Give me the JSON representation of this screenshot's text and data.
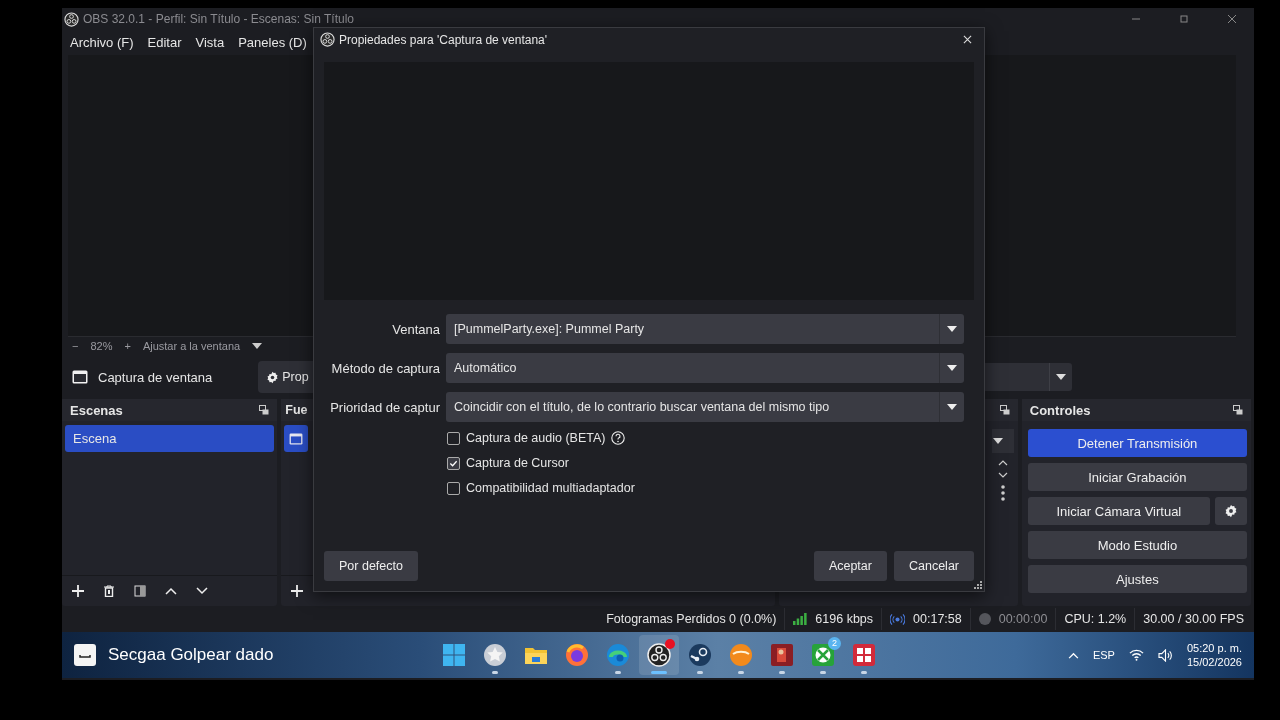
{
  "window": {
    "title": "OBS 32.0.1 - Perfil: Sin Título - Escenas: Sin Título"
  },
  "menu": [
    {
      "label": "Archivo (F)"
    },
    {
      "label": "Editar"
    },
    {
      "label": "Vista"
    },
    {
      "label": "Paneles (D)"
    }
  ],
  "zoom_bar": {
    "minus": "−",
    "zoom": "82%",
    "plus": "+",
    "fit": "Ajustar a la ventana"
  },
  "source_toolbar": {
    "source": "Captura de ventana",
    "properties_button": "Prop"
  },
  "scenes": {
    "title": "Escenas",
    "items": [
      {
        "label": "Escena",
        "selected": true
      }
    ]
  },
  "sources": {
    "title": "Fue",
    "items": [
      {
        "selected": true
      }
    ]
  },
  "controls": {
    "title": "Controles",
    "buttons": [
      {
        "label": "Detener Transmisión",
        "on": true,
        "gear": false
      },
      {
        "label": "Iniciar Grabación",
        "on": false,
        "gear": false
      },
      {
        "label": "Iniciar Cámara Virtual",
        "on": false,
        "gear": true
      },
      {
        "label": "Modo Estudio",
        "on": false,
        "gear": false
      },
      {
        "label": "Ajustes",
        "on": false,
        "gear": false
      }
    ]
  },
  "status_bar": {
    "dropped": "Fotogramas Perdidos 0 (0.0%)",
    "bitrate": "6196 kbps",
    "stream_time": "00:17:58",
    "record_time": "00:00:00",
    "cpu": "CPU: 1.2%",
    "fps": "30.00 / 30.00 FPS"
  },
  "dialog": {
    "title": "Propiedades para 'Captura de ventana'",
    "fields": [
      {
        "label": "Ventana",
        "value": "[PummelParty.exe]: Pummel Party"
      },
      {
        "label": "Método de captura",
        "value": "Automático"
      },
      {
        "label": "Prioridad de captur",
        "value": "Coincidir con el título, de lo contrario buscar ventana del mismo tipo"
      }
    ],
    "checkboxes": [
      {
        "label": "Captura de audio (BETA)",
        "checked": false,
        "help": true
      },
      {
        "label": "Captura de Cursor",
        "checked": true,
        "help": false
      },
      {
        "label": "Compatibilidad multiadaptador",
        "checked": false,
        "help": false
      }
    ],
    "defaults_button": "Por defecto",
    "ok_button": "Aceptar",
    "cancel_button": "Cancelar"
  },
  "taskbar": {
    "widget": "Secgaa Golpear dado",
    "apps": [
      {
        "kind": "start",
        "running": false,
        "active": false,
        "notification": false
      },
      {
        "kind": "star",
        "running": true,
        "active": false,
        "notification": false
      },
      {
        "kind": "folder",
        "running": false,
        "active": false,
        "notification": false
      },
      {
        "kind": "firefox",
        "running": false,
        "active": false,
        "notification": false
      },
      {
        "kind": "edge",
        "running": true,
        "active": false,
        "notification": false
      },
      {
        "kind": "obs",
        "running": true,
        "active": true,
        "notification": true
      },
      {
        "kind": "steam",
        "running": true,
        "active": false,
        "notification": false
      },
      {
        "kind": "orange",
        "running": true,
        "active": false,
        "notification": false
      },
      {
        "kind": "game",
        "running": true,
        "active": false,
        "notification": false
      },
      {
        "kind": "xbox",
        "running": true,
        "active": false,
        "notification": false,
        "badge": "2"
      },
      {
        "kind": "grid",
        "running": true,
        "active": false,
        "notification": false
      }
    ],
    "language": "ESP",
    "time": "05:20 p. m.",
    "date": "15/02/2026"
  }
}
